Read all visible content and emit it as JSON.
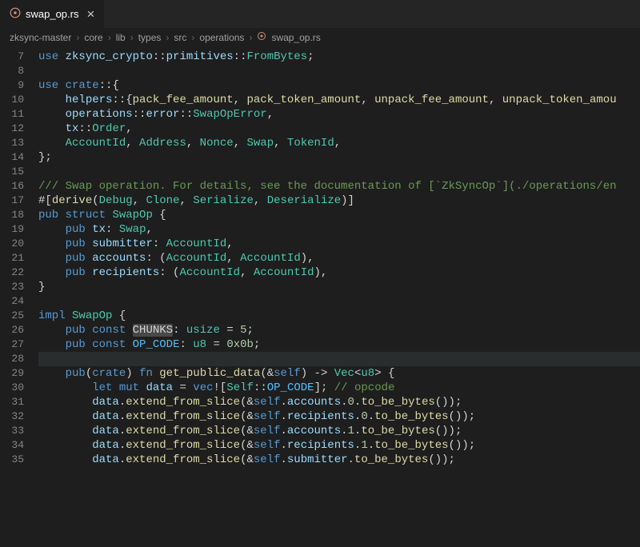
{
  "tab": {
    "icon_name": "rust-icon",
    "label": "swap_op.rs",
    "close": "×"
  },
  "breadcrumbs": {
    "segments": [
      "zksync-master",
      "core",
      "lib",
      "types",
      "src",
      "operations"
    ],
    "file": "swap_op.rs",
    "sep": "›"
  },
  "editor": {
    "first_line": 7,
    "highlight_line": 28,
    "ref_highlight": "CHUNKS",
    "lines": [
      "use zksync_crypto::primitives::FromBytes;",
      "",
      "use crate::{",
      "    helpers::{pack_fee_amount, pack_token_amount, unpack_fee_amount, unpack_token_amou",
      "    operations::error::SwapOpError,",
      "    tx::Order,",
      "    AccountId, Address, Nonce, Swap, TokenId,",
      "};",
      "",
      "/// Swap operation. For details, see the documentation of [`ZkSyncOp`](./operations/en",
      "#[derive(Debug, Clone, Serialize, Deserialize)]",
      "pub struct SwapOp {",
      "    pub tx: Swap,",
      "    pub submitter: AccountId,",
      "    pub accounts: (AccountId, AccountId),",
      "    pub recipients: (AccountId, AccountId),",
      "}",
      "",
      "impl SwapOp {",
      "    pub const CHUNKS: usize = 5;",
      "    pub const OP_CODE: u8 = 0x0b;",
      "",
      "    pub(crate) fn get_public_data(&self) -> Vec<u8> {",
      "        let mut data = vec![Self::OP_CODE]; // opcode",
      "        data.extend_from_slice(&self.accounts.0.to_be_bytes());",
      "        data.extend_from_slice(&self.recipients.0.to_be_bytes());",
      "        data.extend_from_slice(&self.accounts.1.to_be_bytes());",
      "        data.extend_from_slice(&self.recipients.1.to_be_bytes());",
      "        data.extend_from_slice(&self.submitter.to_be_bytes());"
    ]
  }
}
